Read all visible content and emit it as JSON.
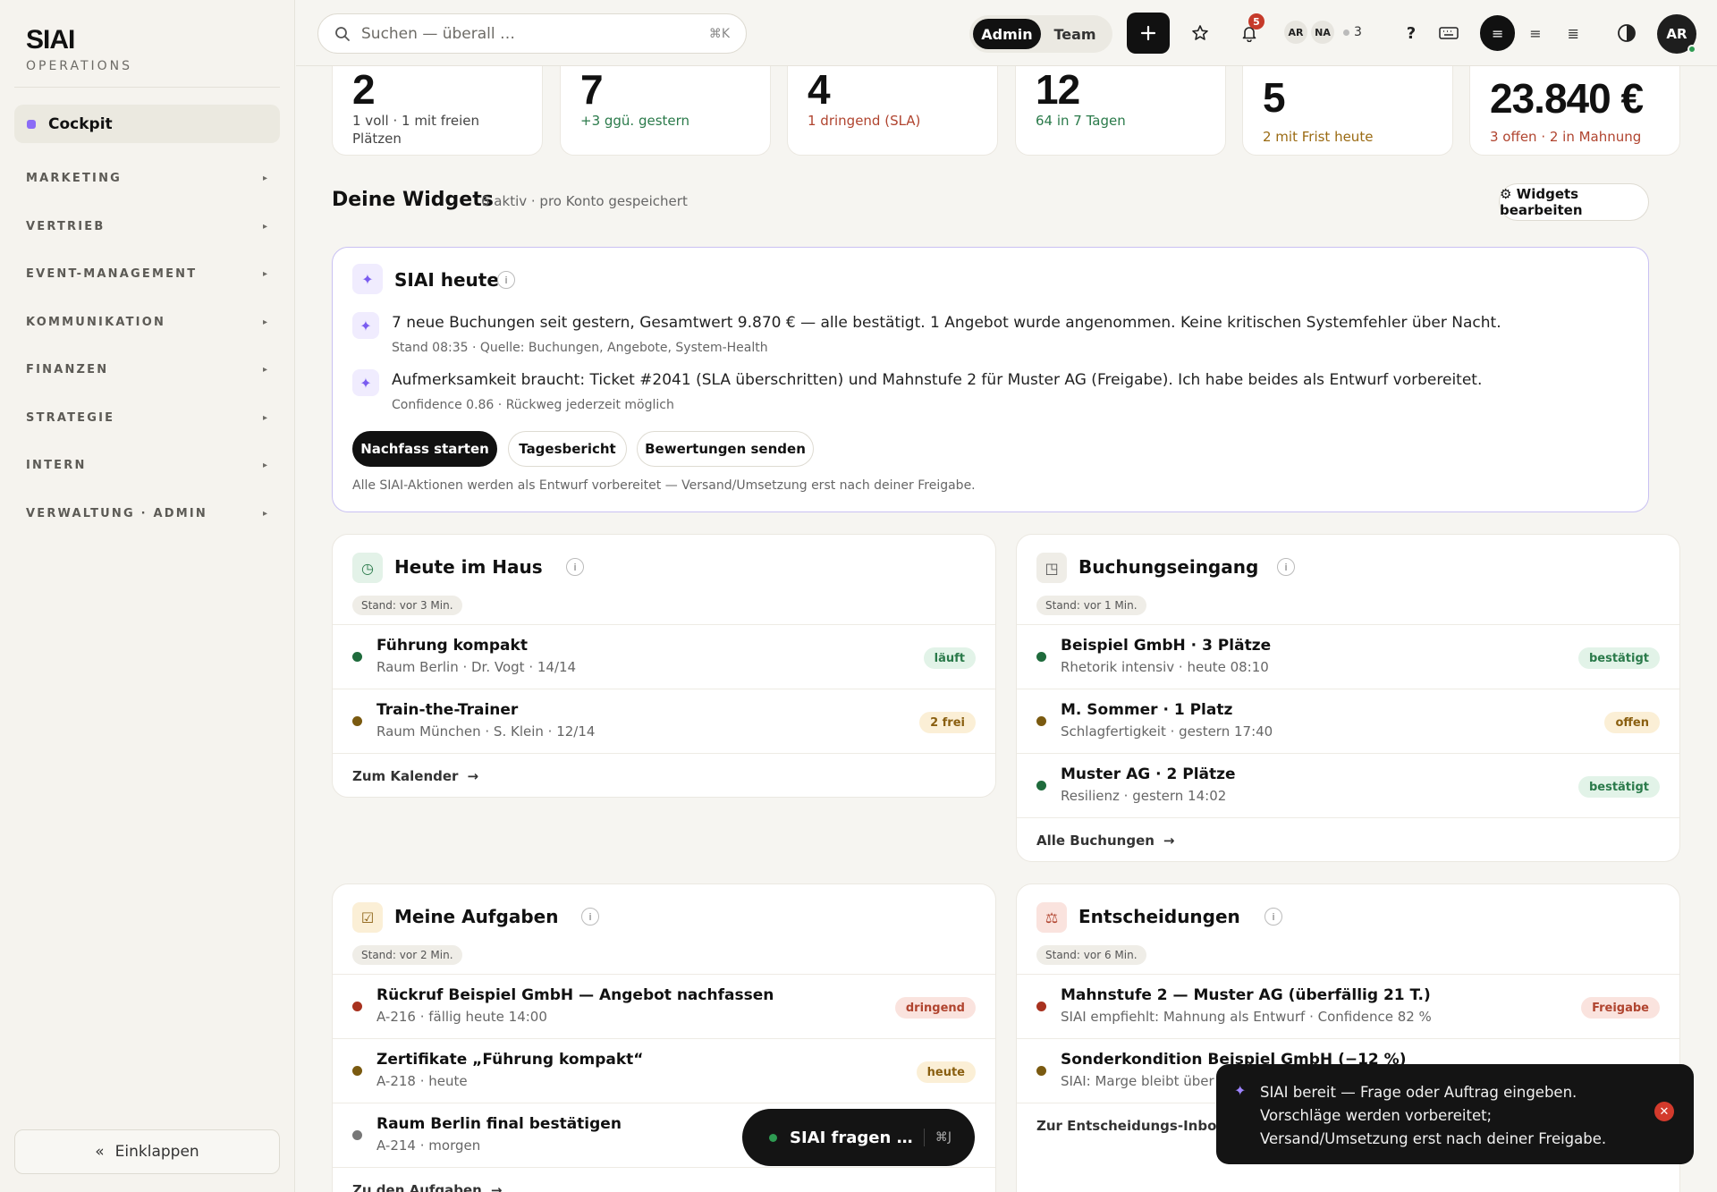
{
  "brand": {
    "name": "SIAI",
    "sub": "OPERATIONS"
  },
  "sidebar": {
    "active": "Cockpit",
    "groups": [
      "MARKETING",
      "VERTRIEB",
      "EVENT-MANAGEMENT",
      "KOMMUNIKATION",
      "FINANZEN",
      "STRATEGIE",
      "INTERN",
      "VERWALTUNG · ADMIN"
    ],
    "chevron": "▸",
    "collapse_icon": "«",
    "collapse_label": "Einklappen"
  },
  "topbar": {
    "search_placeholder": "Suchen — überall …",
    "search_kbd": "⌘K",
    "roles": [
      "Admin",
      "Team"
    ],
    "active_role": "Admin",
    "notifications_count": "5",
    "presence": [
      "AR",
      "NA"
    ],
    "presence_count": "3",
    "user_initials": "AR",
    "icons": [
      "search-icon",
      "plus-icon",
      "star-icon",
      "bell-icon",
      "help-icon",
      "keyboard-icon",
      "density-compact-icon",
      "density-medium-icon",
      "density-comfortable-icon",
      "contrast-icon"
    ]
  },
  "kpis": [
    {
      "value": "2",
      "sub": "1 voll · 1 mit freien Plätzen",
      "tone": "gray"
    },
    {
      "value": "7",
      "sub": "+3 ggü. gestern",
      "tone": "green"
    },
    {
      "value": "4",
      "sub": "1 dringend (SLA)",
      "tone": "red"
    },
    {
      "value": "12",
      "sub": "64 in 7 Tagen",
      "tone": "green"
    },
    {
      "value": "5",
      "sub": "2 mit Frist heute",
      "tone": "amber"
    },
    {
      "value": "23.840 €",
      "sub": "3 offen · 2 in Mahnung",
      "tone": "red"
    }
  ],
  "widgets_header": {
    "title": "Deine Widgets",
    "sub": "6 aktiv · pro Konto gespeichert",
    "edit_label": "⚙ Widgets bearbeiten"
  },
  "siai": {
    "title": "SIAI heute",
    "lines": [
      {
        "text": "7 neue Buchungen seit gestern, Gesamtwert 9.870 € — alle bestätigt. 1 Angebot wurde angenommen. Keine kritischen Systemfehler über Nacht.",
        "meta": "Stand 08:35 · Quelle: Buchungen, Angebote, System-Health"
      },
      {
        "text": "Aufmerksamkeit braucht: Ticket #2041 (SLA überschritten) und Mahnstufe 2 für Muster AG (Freigabe). Ich habe beides als Entwurf vorbereitet.",
        "meta": "Confidence 0.86 · Rückweg jederzeit möglich"
      }
    ],
    "actions": [
      "Nachfass starten",
      "Tagesbericht",
      "Bewertungen senden"
    ],
    "footer": "Alle SIAI-Aktionen werden als Entwurf vorbereitet — Versand/Umsetzung erst nach deiner Freigabe."
  },
  "widgets": {
    "haus": {
      "icon": "◷",
      "title": "Heute im Haus",
      "stand": "Stand: vor 3 Min.",
      "rows": [
        {
          "title": "Führung kompakt",
          "sub": "Raum Berlin · Dr. Vogt · 14/14",
          "tag": "läuft",
          "dot": "#1f6b3c",
          "tone": "g"
        },
        {
          "title": "Train-the-Trainer",
          "sub": "Raum München · S. Klein · 12/14",
          "tag": "2 frei",
          "dot": "#7a5a10",
          "tone": "a"
        }
      ],
      "footer": "Zum Kalender"
    },
    "buchung": {
      "icon": "◳",
      "title": "Buchungseingang",
      "stand": "Stand: vor 1 Min.",
      "rows": [
        {
          "title": "Beispiel GmbH · 3 Plätze",
          "sub": "Rhetorik intensiv · heute 08:10",
          "tag": "bestätigt",
          "dot": "#1f6b3c",
          "tone": "g"
        },
        {
          "title": "M. Sommer · 1 Platz",
          "sub": "Schlagfertigkeit · gestern 17:40",
          "tag": "offen",
          "dot": "#7a5a10",
          "tone": "a"
        },
        {
          "title": "Muster AG · 2 Plätze",
          "sub": "Resilienz · gestern 14:02",
          "tag": "bestätigt",
          "dot": "#1f6b3c",
          "tone": "g"
        }
      ],
      "footer": "Alle Buchungen"
    },
    "aufgaben": {
      "icon": "☑",
      "title": "Meine Aufgaben",
      "stand": "Stand: vor 2 Min.",
      "rows": [
        {
          "title": "Rückruf Beispiel GmbH — Angebot nachfassen",
          "sub": "A-216 · fällig heute 14:00",
          "tag": "dringend",
          "dot": "#a8321f",
          "tone": "r"
        },
        {
          "title": "Zertifikate „Führung kompakt“",
          "sub": "A-218 · heute",
          "tag": "heute",
          "dot": "#7a5a10",
          "tone": "a"
        },
        {
          "title": "Raum Berlin final bestätigen",
          "sub": "A-214 · morgen",
          "tag": "",
          "dot": "#777777",
          "tone": ""
        }
      ],
      "footer": "Zu den Aufgaben"
    },
    "entscheidungen": {
      "icon": "⚖",
      "title": "Entscheidungen",
      "stand": "Stand: vor 6 Min.",
      "rows": [
        {
          "title": "Mahnstufe 2 — Muster AG (überfällig 21 T.)",
          "sub": "SIAI empfiehlt: Mahnung als Entwurf · Confidence 82 %",
          "tag": "Freigabe",
          "dot": "#a8321f",
          "tone": "r"
        },
        {
          "title": "Sonderkondition Beispiel GmbH (−12 %)",
          "sub": "SIAI: Marge bleibt über",
          "tag": "",
          "dot": "#7a5a10",
          "tone": ""
        }
      ],
      "footer": "Zur Entscheidungs-Inbox"
    },
    "arrow": "→"
  },
  "ask": {
    "label": "SIAI fragen …",
    "kbd": "⌘J"
  },
  "toast": {
    "text": "SIAI bereit — Frage oder Auftrag eingeben. Vorschläge werden vorbereitet; Versand/Umsetzung erst nach deiner Freigabe.",
    "close": "✕"
  }
}
